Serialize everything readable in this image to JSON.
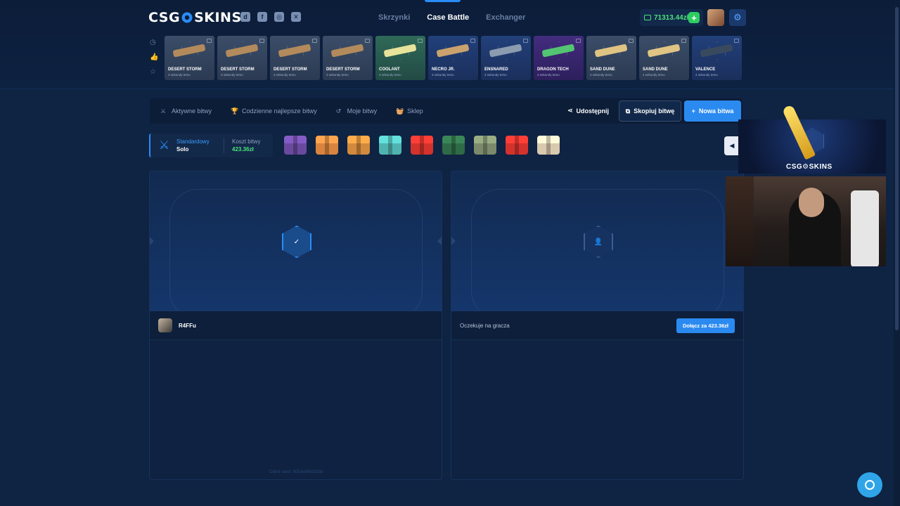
{
  "header": {
    "logo_left": "CSG",
    "logo_right": "SKINS",
    "nav": [
      {
        "label": "Skrzynki",
        "active": false
      },
      {
        "label": "Case Battle",
        "active": true
      },
      {
        "label": "Exchanger",
        "active": false
      }
    ],
    "balance": "71313.44zł",
    "socials": [
      "discord-icon",
      "facebook-icon",
      "instagram-icon",
      "x-icon"
    ]
  },
  "live_drops": [
    {
      "name": "DESERT STORM",
      "sub": "3 sekundy temu",
      "theme": "gray",
      "gun_color": "#b28a5c"
    },
    {
      "name": "DESERT STORM",
      "sub": "3 sekundy temu",
      "theme": "gray",
      "gun_color": "#b28a5c"
    },
    {
      "name": "DESERT STORM",
      "sub": "3 sekundy temu",
      "theme": "gray",
      "gun_color": "#b28a5c"
    },
    {
      "name": "DESERT STORM",
      "sub": "3 sekundy temu",
      "theme": "gray",
      "gun_color": "#b28a5c"
    },
    {
      "name": "COOLANT",
      "sub": "3 sekundy temu",
      "theme": "green",
      "gun_color": "#e7e39a"
    },
    {
      "name": "NECRO JR.",
      "sub": "3 sekundy temu",
      "theme": "blue",
      "gun_color": "#c9a26d"
    },
    {
      "name": "ENSNARED",
      "sub": "3 sekundy temu",
      "theme": "blue",
      "gun_color": "#8b9bb0"
    },
    {
      "name": "DRAGON TECH",
      "sub": "3 sekundy temu",
      "theme": "purple",
      "gun_color": "#53c471"
    },
    {
      "name": "SAND DUNE",
      "sub": "4 sekundy temu",
      "theme": "gray",
      "gun_color": "#e0c484"
    },
    {
      "name": "SAND DUNE",
      "sub": "4 sekundy temu",
      "theme": "gray",
      "gun_color": "#e0c484"
    },
    {
      "name": "VALENCE",
      "sub": "4 sekundy temu",
      "theme": "blue",
      "gun_color": "#3a4a5e"
    }
  ],
  "subnav": {
    "tabs": [
      "Aktywne bitwy",
      "Codzienne najlepsze bitwy",
      "Moje bitwy",
      "Sklep"
    ],
    "share": "Udostępnij",
    "copy": "Skopiuj bitwę",
    "new": "Nowa bitwa"
  },
  "battle": {
    "mode_label": "Standardowy",
    "mode_value": "Solo",
    "cost_label": "Koszt bitwy",
    "cost_value": "423.36zł",
    "cases": [
      {
        "color": "#6a4a9e"
      },
      {
        "color": "#d8843f"
      },
      {
        "color": "#d28a3c"
      },
      {
        "color": "#4fb4b0"
      },
      {
        "color": "#d4322c"
      },
      {
        "color": "#2f6b46"
      },
      {
        "color": "#7b8a6a"
      },
      {
        "color": "#d4322c"
      },
      {
        "color": "#d9c9ae"
      }
    ]
  },
  "players": {
    "left": {
      "name": "R4FFu"
    },
    "right": {
      "waiting": "Oczekuje na gracza",
      "join": "Dołącz za 423.36zł"
    }
  },
  "seed": "Client seed: 8f3c6a9f6d3b3d",
  "stream": {
    "logo_text": "CSG⚙SKINS"
  },
  "colors": {
    "accent": "#2a8cf6",
    "balance": "#4ce27a",
    "bg": "#0f2343"
  }
}
